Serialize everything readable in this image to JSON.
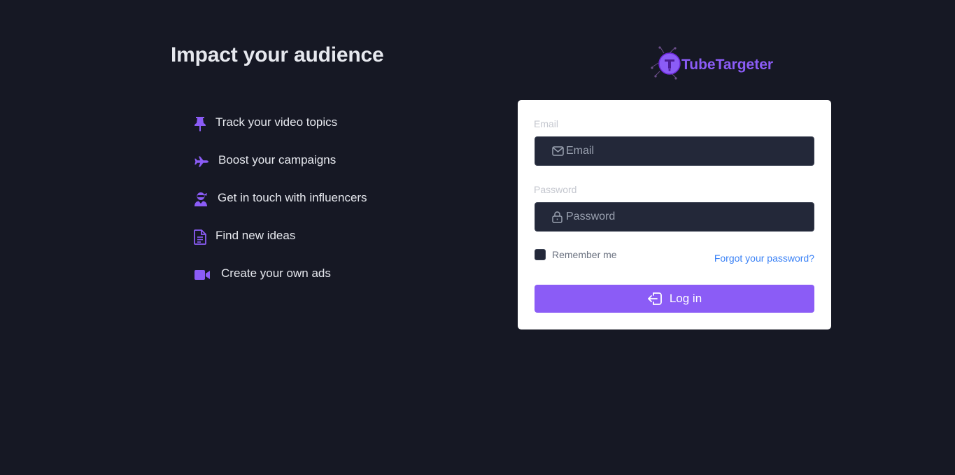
{
  "hero": {
    "title": "Impact your audience"
  },
  "features": [
    {
      "icon": "pin-icon",
      "label": "Track your video topics"
    },
    {
      "icon": "plane-icon",
      "label": "Boost your campaigns"
    },
    {
      "icon": "user-ninja-icon",
      "label": "Get in touch with influencers"
    },
    {
      "icon": "file-icon",
      "label": "Find new ideas"
    },
    {
      "icon": "video-camera-icon",
      "label": "Create your own ads"
    }
  ],
  "brand": {
    "name": "TubeTargeter"
  },
  "login_form": {
    "email": {
      "label": "Email",
      "placeholder": "Email",
      "value": ""
    },
    "password": {
      "label": "Password",
      "placeholder": "Password",
      "value": ""
    },
    "remember_label": "Remember me",
    "remember_checked": false,
    "forgot_label": "Forgot your password?",
    "submit_label": "Log in"
  },
  "colors": {
    "background": "#161824",
    "accent": "#8b5cf6",
    "link": "#3b82f6",
    "input_bg": "#232839",
    "text": "#e6e8ee"
  }
}
